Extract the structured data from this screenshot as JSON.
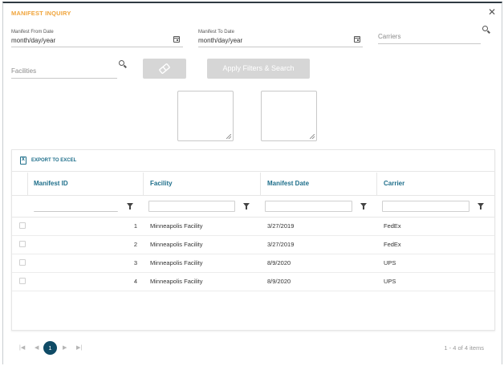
{
  "dialog": {
    "title": "MANIFEST INQUIRY"
  },
  "filters": {
    "from_label": "Manifest From Date",
    "from_value": "month/day/year",
    "to_label": "Manifest To Date",
    "to_value": "month/day/year",
    "carriers_placeholder": "Carriers",
    "facilities_placeholder": "Facilities",
    "apply_label": "Apply Filters & Search"
  },
  "grid": {
    "export_label": "EXPORT TO EXCEL",
    "columns": [
      "Manifest ID",
      "Facility",
      "Manifest Date",
      "Carrier"
    ],
    "rows": [
      {
        "id": "1",
        "facility": "Minneapolis Facility",
        "date": "3/27/2019",
        "carrier": "FedEx"
      },
      {
        "id": "2",
        "facility": "Minneapolis Facility",
        "date": "3/27/2019",
        "carrier": "FedEx"
      },
      {
        "id": "3",
        "facility": "Minneapolis Facility",
        "date": "8/9/2020",
        "carrier": "UPS"
      },
      {
        "id": "4",
        "facility": "Minneapolis Facility",
        "date": "8/9/2020",
        "carrier": "UPS"
      }
    ]
  },
  "pager": {
    "current_page": "1",
    "info": "1 - 4 of 4 items",
    "first_icon": "first-page-icon",
    "prev_icon": "previous-page-icon",
    "next_icon": "next-page-icon",
    "last_icon": "last-page-icon"
  },
  "colors": {
    "accent": "#f0a43a",
    "link": "#1f6f8b",
    "pager_active": "#0f4b66",
    "disabled_button": "#d6d6d6"
  }
}
